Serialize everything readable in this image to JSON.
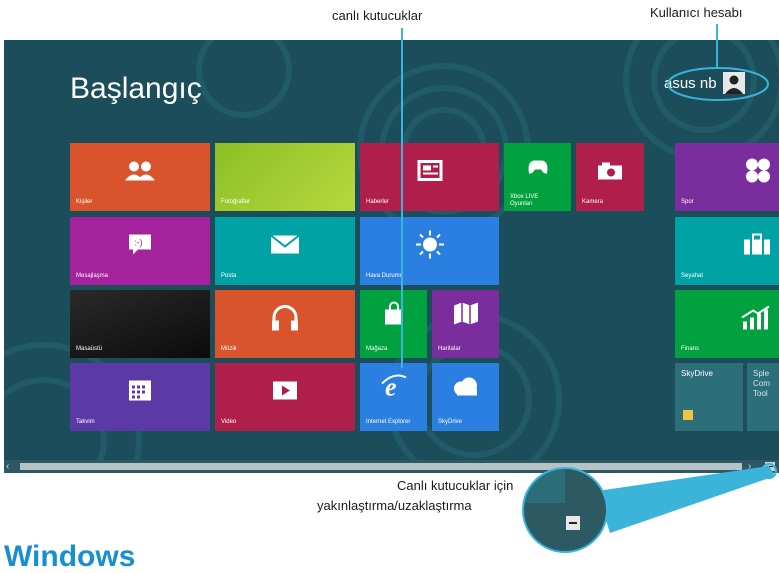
{
  "callouts": {
    "live_tiles": "canlı kutucuklar",
    "user_account": "Kullanıcı hesabı",
    "zoom_line1": "Canlı kutucuklar için",
    "zoom_line2": "yakınlaştırma/uzaklaştırma"
  },
  "start": {
    "title": "Başlangıç",
    "user_name": "asus nb"
  },
  "tiles": {
    "kisiler": "Kişiler",
    "fotograflar": "Fotoğraflar",
    "haberler": "Haberler",
    "xbox_1": "Xbox LIVE",
    "xbox_2": "Oyunları",
    "kamera": "Kamera",
    "spor": "Spor",
    "mesajlasma": "Mesajlaşma",
    "posta": "Posta",
    "hava": "Hava Durumu",
    "seyahat": "Seyahat",
    "masaustu": "Masaüstü",
    "muzik": "Müzik",
    "magaza": "Mağaza",
    "haritalar": "Haritalar",
    "finans": "Finans",
    "takvim": "Takvim",
    "video": "Video",
    "ie": "Internet Explorer",
    "skydrive": "SkyDrive",
    "skydrive2": "SkyDrive",
    "sple_1": "Sple",
    "sple_2": "Com",
    "sple_3": "Tool"
  },
  "footer": {
    "windows_partial": "Windows"
  },
  "colors": {
    "background": "#1b4e5a",
    "orange": "#d9532c",
    "lime": "#8cbf26",
    "crimson": "#b01e4c",
    "green": "#00a13e",
    "purple": "#7a2e9e",
    "magenta": "#a4229b",
    "teal": "#00a2a6",
    "blue": "#2b7fe0",
    "indigo": "#5b3aa6",
    "callout": "#3ab4d8"
  }
}
